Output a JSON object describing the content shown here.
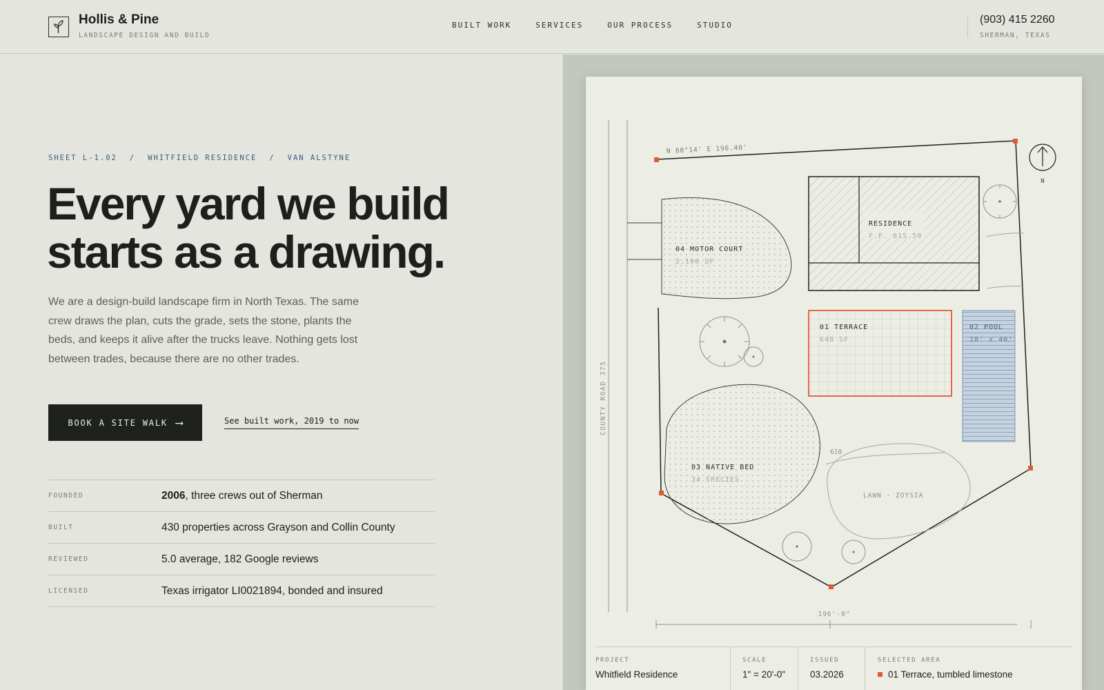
{
  "brand": {
    "name": "Hollis & Pine",
    "tagline": "LANDSCAPE DESIGN AND BUILD",
    "phone": "(903) 415 2260",
    "location": "SHERMAN, TEXAS"
  },
  "nav": [
    "BUILT WORK",
    "SERVICES",
    "OUR PROCESS",
    "STUDIO"
  ],
  "breadcrumb": [
    "SHEET L-1.02",
    "WHITFIELD RESIDENCE",
    "VAN ALSTYNE"
  ],
  "breadcrumb_separator": "/",
  "hero": {
    "headline_line1": "Every yard we build",
    "headline_line2": "starts as a drawing.",
    "lead": "We are a design-build landscape firm in North Texas. The same crew draws the plan, cuts the grade, sets the stone, plants the beds, and keeps it alive after the trucks leave. Nothing gets lost between trades, because there are no other trades.",
    "cta_label": "BOOK A SITE WALK",
    "cta_arrow": "⟶",
    "secondary_link": "See built work, 2019 to now"
  },
  "facts": [
    {
      "label": "FOUNDED",
      "strong": "2006",
      "rest": ", three crews out of Sherman"
    },
    {
      "label": "BUILT",
      "strong": "",
      "rest": "430 properties across Grayson and Collin County"
    },
    {
      "label": "REVIEWED",
      "strong": "",
      "rest": "5.0 average, 182 Google reviews"
    },
    {
      "label": "LICENSED",
      "strong": "",
      "rest": "Texas irrigator LI0021894, bonded and insured"
    }
  ],
  "plan": {
    "bearing": "N 88°14' E  196.40'",
    "road": "COUNTY ROAD 375",
    "north": "N",
    "residence_label": "RESIDENCE",
    "residence_ff": "F.F. 615.50",
    "motor_court_label": "04 MOTOR COURT",
    "motor_court_area": "2,100 SF",
    "terrace_label": "01 TERRACE",
    "terrace_area": "640 SF",
    "pool_label": "02 POOL",
    "pool_size": "18' x 40'",
    "native_bed_label": "03 NATIVE BED",
    "native_bed_species": "34 SPECIES",
    "contour": "610",
    "lawn_label": "LAWN · ZOYSIA",
    "dimension": "196'-0\""
  },
  "titleblock": {
    "project_label": "PROJECT",
    "project_value": "Whitfield Residence",
    "scale_label": "SCALE",
    "scale_value": "1\" = 20'-0\"",
    "issued_label": "ISSUED",
    "issued_value": "03.2026",
    "selected_label": "SELECTED AREA",
    "selected_value": "01 Terrace, tumbled limestone"
  },
  "colors": {
    "accent": "#e05a36",
    "ink": "#1c1f1b",
    "blue": "#3d5a7a",
    "pool": "#c5d3e0"
  }
}
